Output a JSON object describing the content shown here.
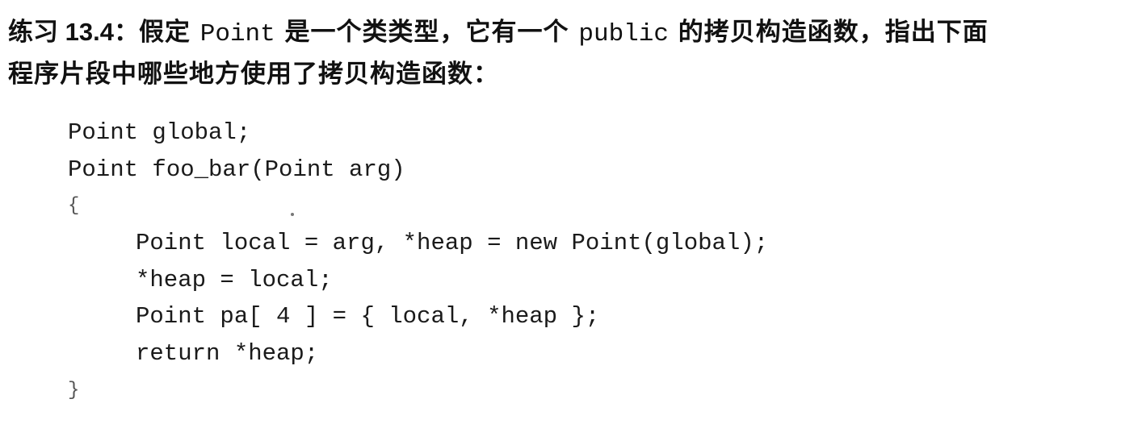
{
  "exercise": {
    "number": "练习 13.4：",
    "text_before_point": "假定 ",
    "type_name": "Point",
    "text_after_point": " 是一个类类型，它有一个 ",
    "keyword_public": "public",
    "text_after_public": " 的拷贝构造函数，指出下面",
    "line2": "程序片段中哪些地方使用了拷贝构造函数："
  },
  "code": {
    "lines": [
      "Point global;",
      "Point foo_bar(Point arg)",
      "{",
      "Point local = arg, *heap = new Point(global);",
      "*heap = local;",
      "Point pa[ 4 ] = { local, *heap };",
      "return *heap;",
      "}"
    ]
  }
}
